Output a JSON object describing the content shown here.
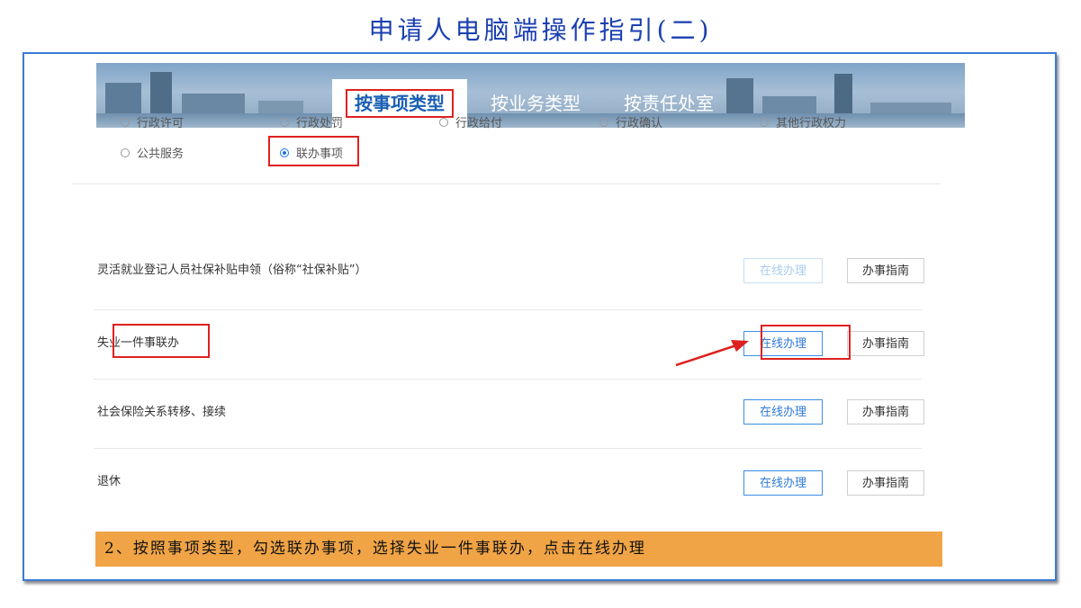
{
  "slide": {
    "title": "申请人电脑端操作指引(二)"
  },
  "tabs": [
    {
      "label": "按事项类型",
      "active": true
    },
    {
      "label": "按业务类型",
      "active": false
    },
    {
      "label": "按责任处室",
      "active": false
    }
  ],
  "filters": [
    {
      "label": "行政许可",
      "selected": false
    },
    {
      "label": "行政处罚",
      "selected": false
    },
    {
      "label": "行政给付",
      "selected": false
    },
    {
      "label": "行政确认",
      "selected": false
    },
    {
      "label": "其他行政权力",
      "selected": false
    },
    {
      "label": "公共服务",
      "selected": false
    },
    {
      "label": "联办事项",
      "selected": true
    }
  ],
  "items": [
    {
      "name": "灵活就业登记人员社保补贴申领（俗称“社保补贴”）",
      "online_label": "在线办理",
      "guide_label": "办事指南"
    },
    {
      "name": "失业一件事联办",
      "online_label": "在线办理",
      "guide_label": "办事指南"
    },
    {
      "name": "社会保险关系转移、接续",
      "online_label": "在线办理",
      "guide_label": "办事指南"
    },
    {
      "name": "退休",
      "online_label": "在线办理",
      "guide_label": "办事指南"
    }
  ],
  "caption": "2、按照事项类型，勾选联办事项，选择失业一件事联办，点击在线办理",
  "colors": {
    "accent": "#2f7bd8",
    "highlight": "#e02020",
    "caption_bg": "#f0a445",
    "title": "#1a3fb0"
  }
}
